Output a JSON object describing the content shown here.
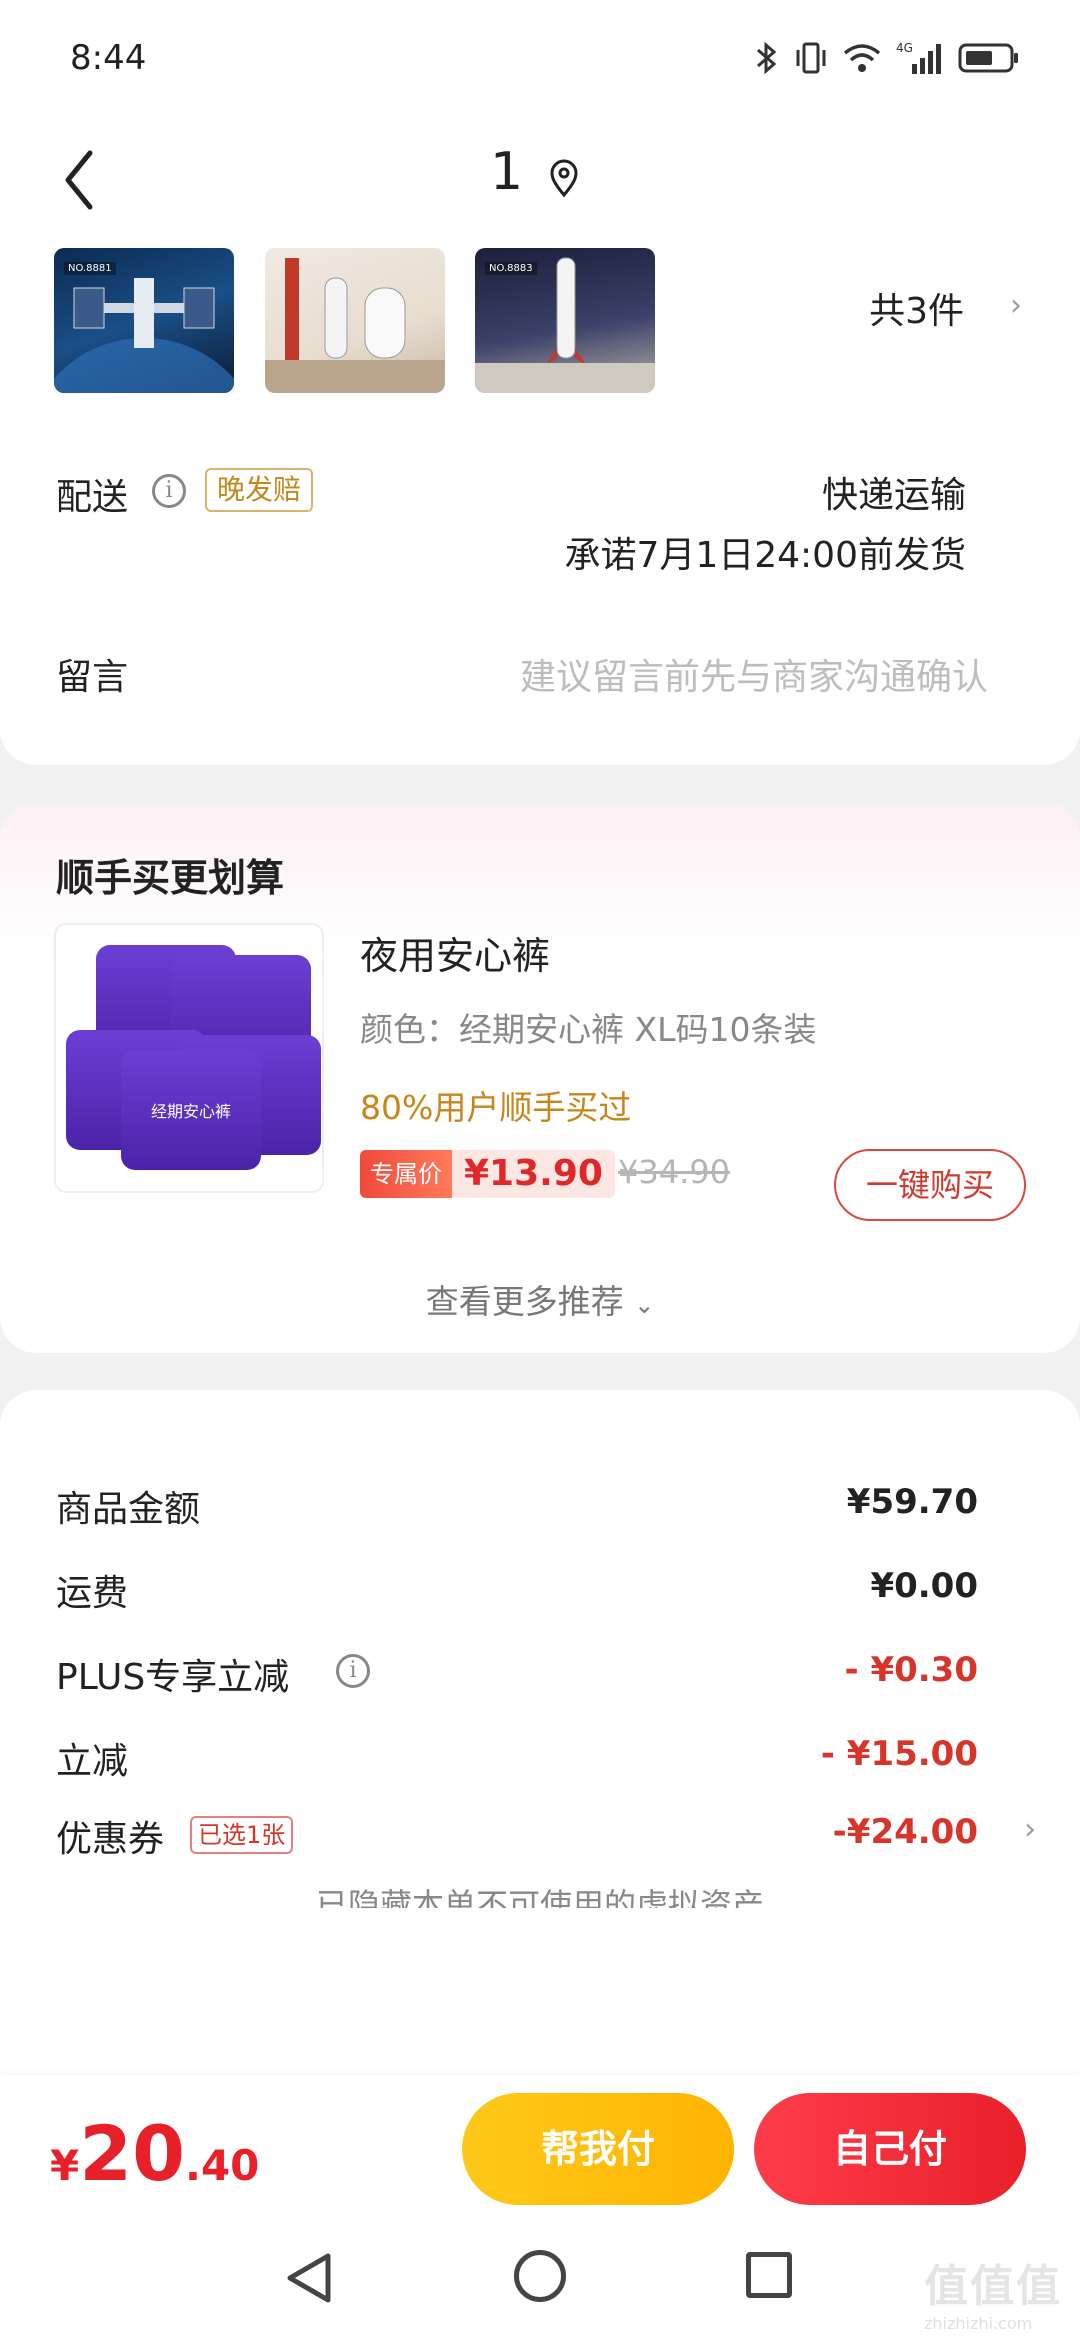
{
  "status_bar": {
    "time": "8:44",
    "network": "4G"
  },
  "header": {
    "title": "1"
  },
  "products": {
    "thumbnails": [
      "NO.8881",
      "",
      "NO.8883"
    ],
    "count_label": "共3件"
  },
  "delivery": {
    "label": "配送",
    "badge": "晚发赔",
    "method": "快递运输",
    "promise": "承诺7月1日24:00前发货"
  },
  "message": {
    "label": "留言",
    "placeholder": "建议留言前先与商家沟通确认"
  },
  "recommend": {
    "heading": "顺手买更划算",
    "product_name": "夜用安心裤",
    "spec": "颜色：经期安心裤 XL码10条装",
    "social": "80%用户顺手买过",
    "price_tag": "专属价",
    "price": "¥13.90",
    "original_price": "¥34.90",
    "buy_button": "一键购买",
    "more": "查看更多推荐",
    "package_text": "经期安心裤"
  },
  "fees": {
    "goods_label": "商品金额",
    "goods_value": "¥59.70",
    "shipping_label": "运费",
    "shipping_value": "¥0.00",
    "plus_label": "PLUS专享立减",
    "plus_value": "- ¥0.30",
    "discount_label": "立减",
    "discount_value": "- ¥15.00",
    "coupon_label": "优惠券",
    "coupon_badge": "已选1张",
    "coupon_value": "-¥24.00",
    "hidden_tip": "已隐藏本单不可使用的虚拟资产"
  },
  "pay": {
    "currency": "¥",
    "total_int": "20",
    "total_dec": ".40",
    "help_pay": "帮我付",
    "self_pay": "自己付"
  },
  "watermark": {
    "text": "值值值",
    "url": "zhizhizhi.com"
  },
  "colors": {
    "accent_red": "#e8202a",
    "accent_yellow": "#ffb400",
    "gold": "#c8861a"
  }
}
